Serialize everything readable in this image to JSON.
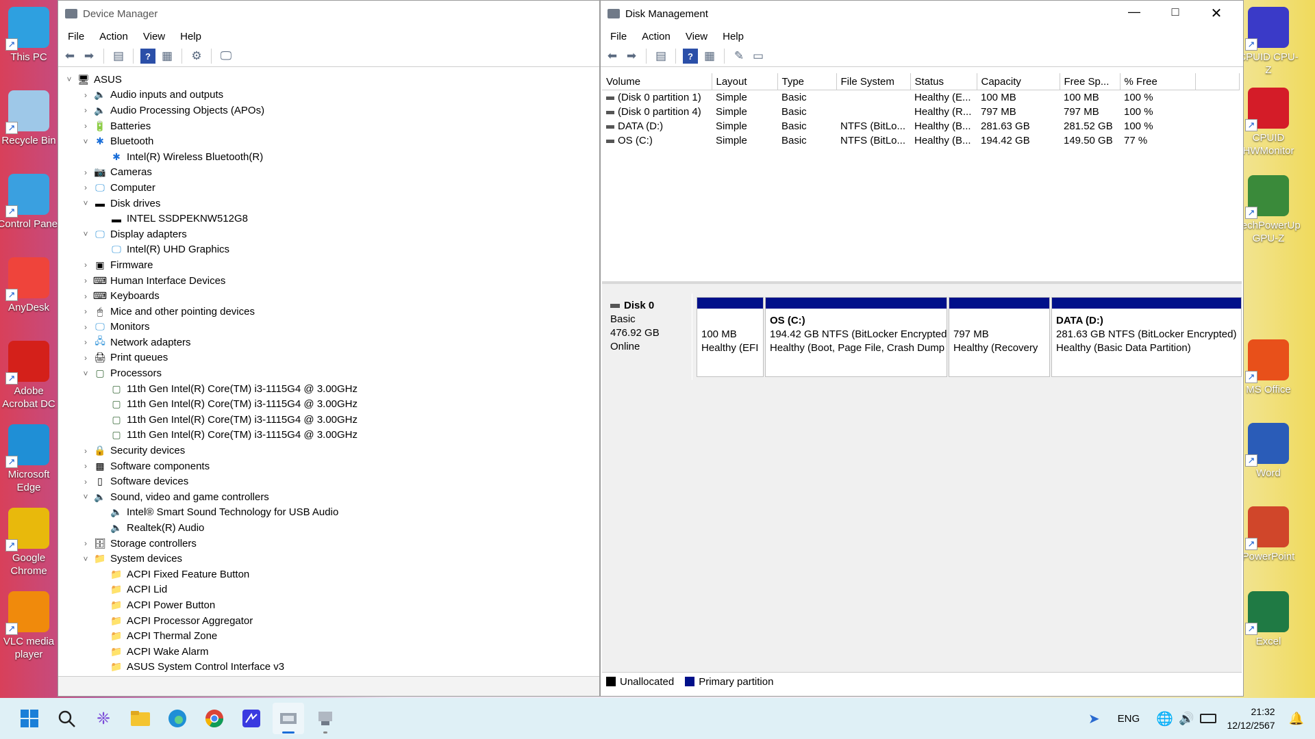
{
  "desktop_left": [
    {
      "label": "This PC",
      "color": "#2ea0e0"
    },
    {
      "label": "Recycle Bin",
      "color": "#9ec8e8"
    },
    {
      "label": "Control Panel",
      "color": "#3aa0e0"
    },
    {
      "label": "AnyDesk",
      "color": "#ef443b"
    },
    {
      "label": "Adobe Acrobat DC",
      "color": "#d4201a"
    },
    {
      "label": "Microsoft Edge",
      "color": "#1f8fd6"
    },
    {
      "label": "Google Chrome",
      "color": "#e8b90c"
    },
    {
      "label": "VLC media player",
      "color": "#f08a0c"
    }
  ],
  "desktop_right": [
    {
      "label": "CPUID CPU-Z",
      "color": "#3a3ac8"
    },
    {
      "label": "CPUID HWMonitor",
      "color": "#d41c28"
    },
    {
      "label": "TechPowerUp GPU-Z",
      "color": "#3a8a3a"
    },
    {
      "label": "MS Office",
      "color": "#e8501a"
    },
    {
      "label": "Word",
      "color": "#2a5cb8"
    },
    {
      "label": "PowerPoint",
      "color": "#d0462a"
    },
    {
      "label": "Excel",
      "color": "#1f7a44"
    }
  ],
  "device_manager": {
    "title": "Device Manager",
    "menu": [
      "File",
      "Action",
      "View",
      "Help"
    ],
    "tree": [
      {
        "level": 0,
        "chev": "v",
        "label": "ASUS",
        "icon": "pc"
      },
      {
        "level": 1,
        "chev": ">",
        "label": "Audio inputs and outputs",
        "icon": "audio"
      },
      {
        "level": 1,
        "chev": ">",
        "label": "Audio Processing Objects (APOs)",
        "icon": "audio"
      },
      {
        "level": 1,
        "chev": ">",
        "label": "Batteries",
        "icon": "battery"
      },
      {
        "level": 1,
        "chev": "v",
        "label": "Bluetooth",
        "icon": "bluetooth"
      },
      {
        "level": 2,
        "chev": "",
        "label": "Intel(R) Wireless Bluetooth(R)",
        "icon": "bluetooth"
      },
      {
        "level": 1,
        "chev": ">",
        "label": "Cameras",
        "icon": "camera"
      },
      {
        "level": 1,
        "chev": ">",
        "label": "Computer",
        "icon": "monitor"
      },
      {
        "level": 1,
        "chev": "v",
        "label": "Disk drives",
        "icon": "disk"
      },
      {
        "level": 2,
        "chev": "",
        "label": "INTEL SSDPEKNW512G8",
        "icon": "disk"
      },
      {
        "level": 1,
        "chev": "v",
        "label": "Display adapters",
        "icon": "display"
      },
      {
        "level": 2,
        "chev": "",
        "label": "Intel(R) UHD Graphics",
        "icon": "display"
      },
      {
        "level": 1,
        "chev": ">",
        "label": "Firmware",
        "icon": "chip"
      },
      {
        "level": 1,
        "chev": ">",
        "label": "Human Interface Devices",
        "icon": "hid"
      },
      {
        "level": 1,
        "chev": ">",
        "label": "Keyboards",
        "icon": "keyboard"
      },
      {
        "level": 1,
        "chev": ">",
        "label": "Mice and other pointing devices",
        "icon": "mouse"
      },
      {
        "level": 1,
        "chev": ">",
        "label": "Monitors",
        "icon": "monitor"
      },
      {
        "level": 1,
        "chev": ">",
        "label": "Network adapters",
        "icon": "network"
      },
      {
        "level": 1,
        "chev": ">",
        "label": "Print queues",
        "icon": "printer"
      },
      {
        "level": 1,
        "chev": "v",
        "label": "Processors",
        "icon": "cpu"
      },
      {
        "level": 2,
        "chev": "",
        "label": "11th Gen Intel(R) Core(TM) i3-1115G4 @ 3.00GHz",
        "icon": "cpu"
      },
      {
        "level": 2,
        "chev": "",
        "label": "11th Gen Intel(R) Core(TM) i3-1115G4 @ 3.00GHz",
        "icon": "cpu"
      },
      {
        "level": 2,
        "chev": "",
        "label": "11th Gen Intel(R) Core(TM) i3-1115G4 @ 3.00GHz",
        "icon": "cpu"
      },
      {
        "level": 2,
        "chev": "",
        "label": "11th Gen Intel(R) Core(TM) i3-1115G4 @ 3.00GHz",
        "icon": "cpu"
      },
      {
        "level": 1,
        "chev": ">",
        "label": "Security devices",
        "icon": "security"
      },
      {
        "level": 1,
        "chev": ">",
        "label": "Software components",
        "icon": "component"
      },
      {
        "level": 1,
        "chev": ">",
        "label": "Software devices",
        "icon": "device"
      },
      {
        "level": 1,
        "chev": "v",
        "label": "Sound, video and game controllers",
        "icon": "audio"
      },
      {
        "level": 2,
        "chev": "",
        "label": "Intel® Smart Sound Technology for USB Audio",
        "icon": "audio"
      },
      {
        "level": 2,
        "chev": "",
        "label": "Realtek(R) Audio",
        "icon": "audio"
      },
      {
        "level": 1,
        "chev": ">",
        "label": "Storage controllers",
        "icon": "storage"
      },
      {
        "level": 1,
        "chev": "v",
        "label": "System devices",
        "icon": "sysfolder"
      },
      {
        "level": 2,
        "chev": "",
        "label": "ACPI Fixed Feature Button",
        "icon": "sysfolder"
      },
      {
        "level": 2,
        "chev": "",
        "label": "ACPI Lid",
        "icon": "sysfolder"
      },
      {
        "level": 2,
        "chev": "",
        "label": "ACPI Power Button",
        "icon": "sysfolder"
      },
      {
        "level": 2,
        "chev": "",
        "label": "ACPI Processor Aggregator",
        "icon": "sysfolder"
      },
      {
        "level": 2,
        "chev": "",
        "label": "ACPI Thermal Zone",
        "icon": "sysfolder"
      },
      {
        "level": 2,
        "chev": "",
        "label": "ACPI Wake Alarm",
        "icon": "sysfolder"
      },
      {
        "level": 2,
        "chev": "",
        "label": "ASUS System Control Interface v3",
        "icon": "sysfolder"
      }
    ]
  },
  "disk_management": {
    "title": "Disk Management",
    "menu": [
      "File",
      "Action",
      "View",
      "Help"
    ],
    "columns": [
      "Volume",
      "Layout",
      "Type",
      "File System",
      "Status",
      "Capacity",
      "Free Sp...",
      "% Free"
    ],
    "rows": [
      [
        "(Disk 0 partition 1)",
        "Simple",
        "Basic",
        "",
        "Healthy (E...",
        "100 MB",
        "100 MB",
        "100 %"
      ],
      [
        "(Disk 0 partition 4)",
        "Simple",
        "Basic",
        "",
        "Healthy (R...",
        "797 MB",
        "797 MB",
        "100 %"
      ],
      [
        "DATA (D:)",
        "Simple",
        "Basic",
        "NTFS (BitLo...",
        "Healthy (B...",
        "281.63 GB",
        "281.52 GB",
        "100 %"
      ],
      [
        "OS (C:)",
        "Simple",
        "Basic",
        "NTFS (BitLo...",
        "Healthy (B...",
        "194.42 GB",
        "149.50 GB",
        "77 %"
      ]
    ],
    "disk": {
      "name": "Disk 0",
      "type": "Basic",
      "size": "476.92 GB",
      "state": "Online"
    },
    "partitions": [
      {
        "title": "",
        "line1": "100 MB",
        "line2": "Healthy (EFI"
      },
      {
        "title": "OS  (C:)",
        "line1": "194.42 GB NTFS (BitLocker Encrypted)",
        "line2": "Healthy (Boot, Page File, Crash Dump"
      },
      {
        "title": "",
        "line1": "797 MB",
        "line2": "Healthy (Recovery"
      },
      {
        "title": "DATA  (D:)",
        "line1": "281.63 GB NTFS (BitLocker Encrypted)",
        "line2": "Healthy (Basic Data Partition)"
      }
    ],
    "legend": [
      {
        "label": "Unallocated",
        "color": "#000000"
      },
      {
        "label": "Primary partition",
        "color": "#00108a"
      }
    ]
  },
  "taskbar": {
    "tray_lang": "ENG",
    "time": "21:32",
    "date": "12/12/2567"
  }
}
